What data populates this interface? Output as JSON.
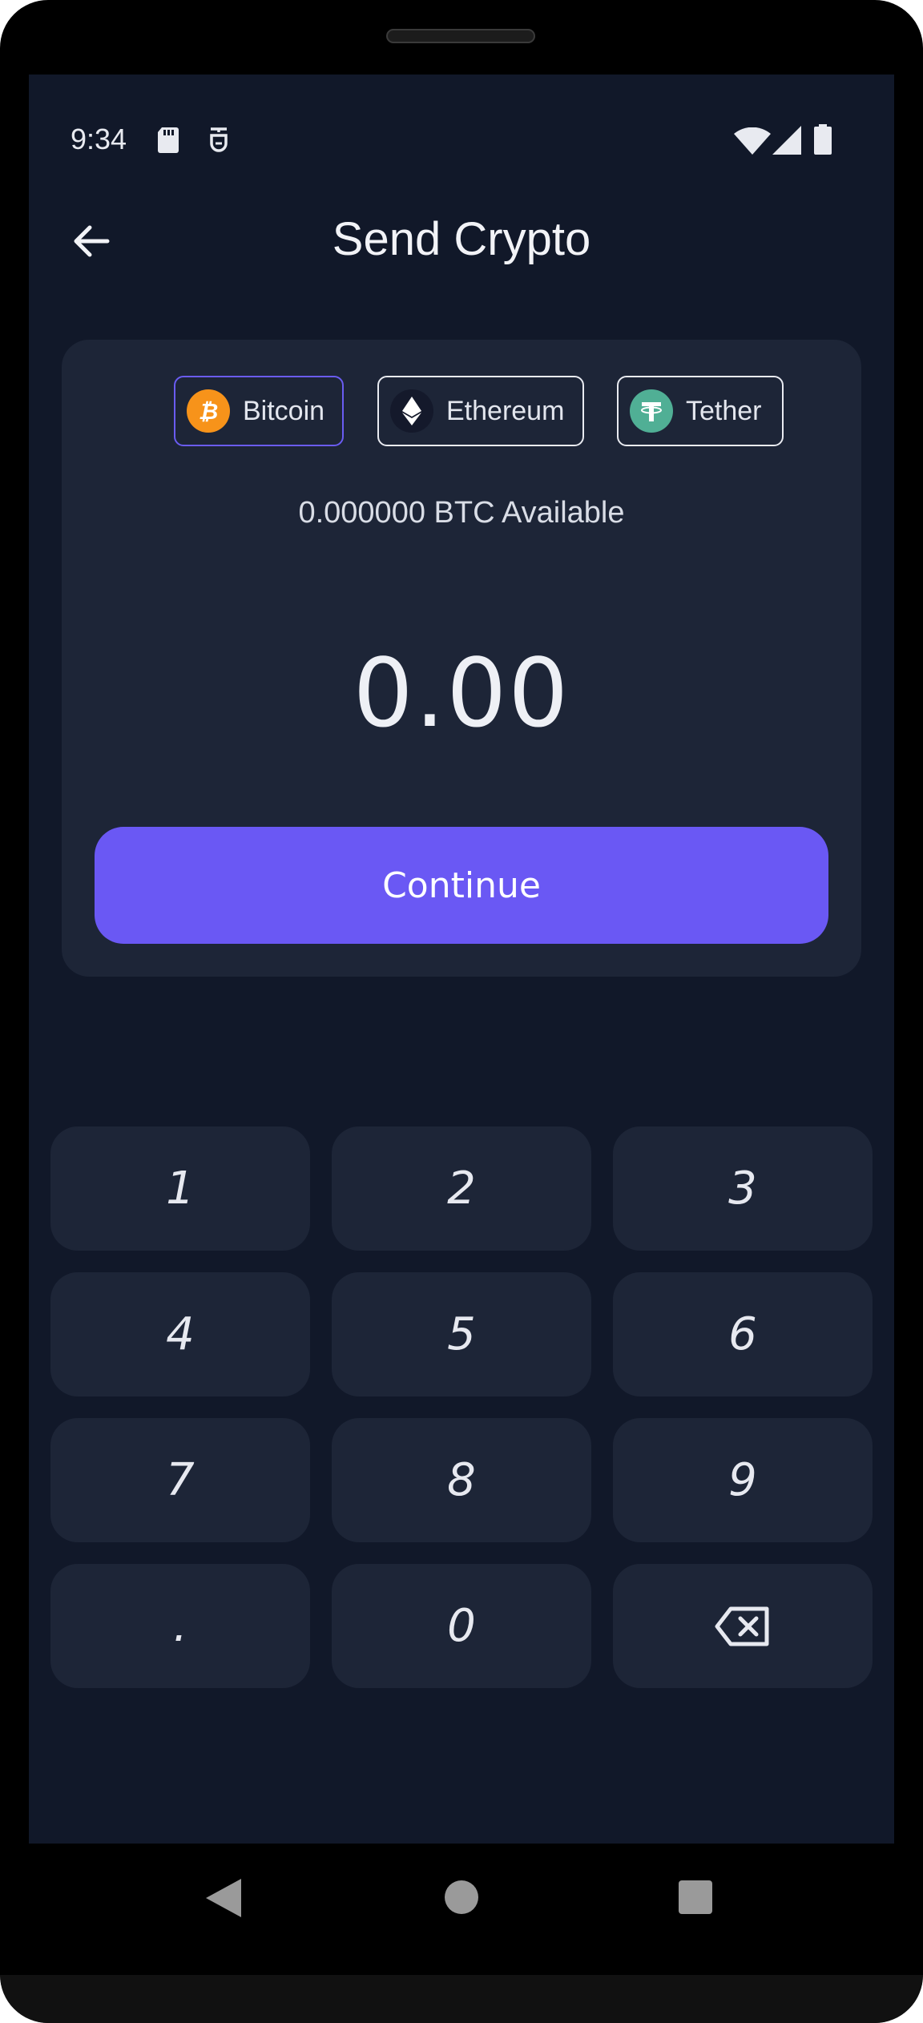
{
  "status_bar": {
    "time": "9:34",
    "icons": [
      "sd-card-icon",
      "app-notification-icon",
      "wifi-icon",
      "signal-icon",
      "battery-icon"
    ]
  },
  "header": {
    "title": "Send Crypto",
    "back_icon": "arrow-left-icon"
  },
  "coins": [
    {
      "label": "Bitcoin",
      "icon": "bitcoin-icon",
      "color": "#f7931a",
      "selected": true
    },
    {
      "label": "Ethereum",
      "icon": "ethereum-icon",
      "color": "#14192b",
      "selected": false
    },
    {
      "label": "Tether",
      "icon": "tether-icon",
      "color": "#50af95",
      "selected": false
    }
  ],
  "balance": {
    "available_text": "0.000000 BTC Available"
  },
  "amount": {
    "value": "0.00"
  },
  "continue_button": {
    "label": "Continue"
  },
  "keypad": {
    "keys": [
      "1",
      "2",
      "3",
      "4",
      "5",
      "6",
      "7",
      "8",
      "9",
      ".",
      "0"
    ],
    "backspace_icon": "backspace-icon"
  },
  "navigation_bar": {
    "buttons": [
      "back-triangle-icon",
      "home-circle-icon",
      "recents-square-icon"
    ]
  },
  "colors": {
    "background": "#111829",
    "card": "#1d2537",
    "accent": "#6a58f4",
    "text": "#eef0f5"
  }
}
